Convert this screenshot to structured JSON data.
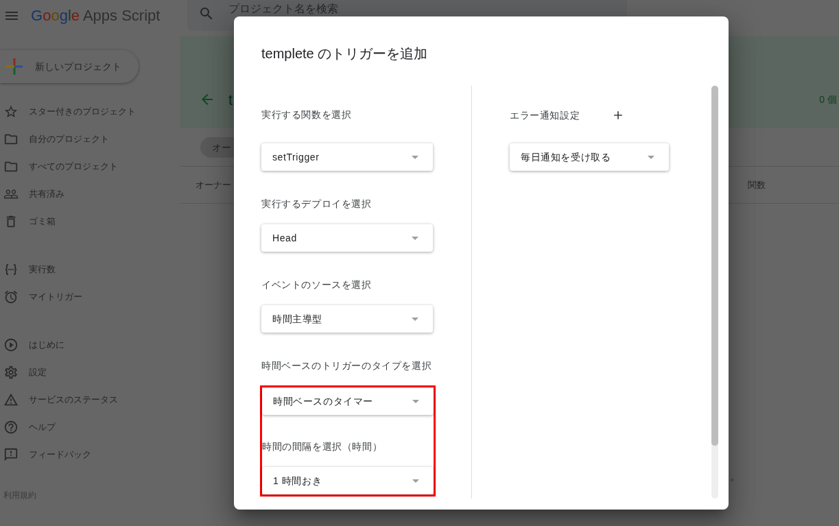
{
  "header": {
    "logo": {
      "brand": "Google",
      "product": "Apps Script"
    },
    "search": {
      "placeholder": "プロジェクト名を検索"
    }
  },
  "sidebar": {
    "new_project_button": {
      "label": "新しいプロジェクト"
    },
    "groups": [
      {
        "items": [
          {
            "label": "スター付きのプロジェクト"
          },
          {
            "label": "自分のプロジェクト"
          },
          {
            "label": "すべてのプロジェクト"
          },
          {
            "label": "共有済み"
          },
          {
            "label": "ゴミ箱"
          }
        ]
      },
      {
        "items": [
          {
            "label": "実行数"
          },
          {
            "label": "マイトリガー"
          }
        ]
      },
      {
        "items": [
          {
            "label": "はじめに"
          },
          {
            "label": "設定"
          },
          {
            "label": "サービスのステータス"
          },
          {
            "label": "ヘルプ"
          },
          {
            "label": "フィードバック"
          }
        ]
      }
    ],
    "footer_link": "利用規約"
  },
  "project_banner": {
    "title": "t",
    "count": "0 個"
  },
  "filter_chip": {
    "label": "オー"
  },
  "table": {
    "columns": [
      "オーナー",
      "関数"
    ]
  },
  "page_text": "。",
  "dialog": {
    "title": "templete のトリガーを追加",
    "fields": [
      {
        "label": "実行する関数を選択",
        "value": "setTrigger",
        "highlighted": false
      },
      {
        "label": "実行するデプロイを選択",
        "value": "Head",
        "highlighted": false
      },
      {
        "label": "イベントのソースを選択",
        "value": "時間主導型",
        "highlighted": false
      },
      {
        "label": "時間ベースのトリガーのタイプを選択",
        "value": "時間ベースのタイマー",
        "highlighted": true
      },
      {
        "label": "時間の間隔を選択（時間）",
        "value": "1 時間おき",
        "highlighted": true
      }
    ],
    "error_notification": {
      "label": "エラー通知設定",
      "value": "毎日通知を受け取る"
    }
  }
}
